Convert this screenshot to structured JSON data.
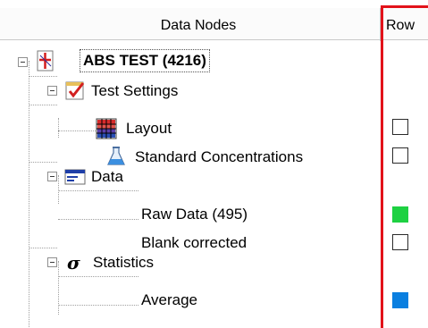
{
  "header": {
    "columns": [
      "Data Nodes",
      "Row"
    ]
  },
  "tree": {
    "root": {
      "label": "ABS TEST (4216)",
      "icon": "plus-chart-icon"
    },
    "groups": [
      {
        "label": "Test Settings",
        "icon": "checklist-icon",
        "children": [
          {
            "label": "Layout",
            "icon": "grid-layout-icon",
            "row": "unchecked"
          },
          {
            "label": "Standard Concentrations",
            "icon": "flask-icon",
            "row": "unchecked"
          }
        ]
      },
      {
        "label": "Data",
        "icon": "data-window-icon",
        "children": [
          {
            "label": "Raw Data (495)",
            "row": "green"
          },
          {
            "label": "Blank corrected",
            "row": "unchecked"
          }
        ]
      },
      {
        "label": "Statistics",
        "icon": "sigma-icon",
        "children": [
          {
            "label": "Average",
            "row": "blue"
          }
        ]
      }
    ]
  },
  "colors": {
    "highlight_border": "#e2121a",
    "row_green": "#1ed142",
    "row_blue": "#0a7fe0"
  }
}
